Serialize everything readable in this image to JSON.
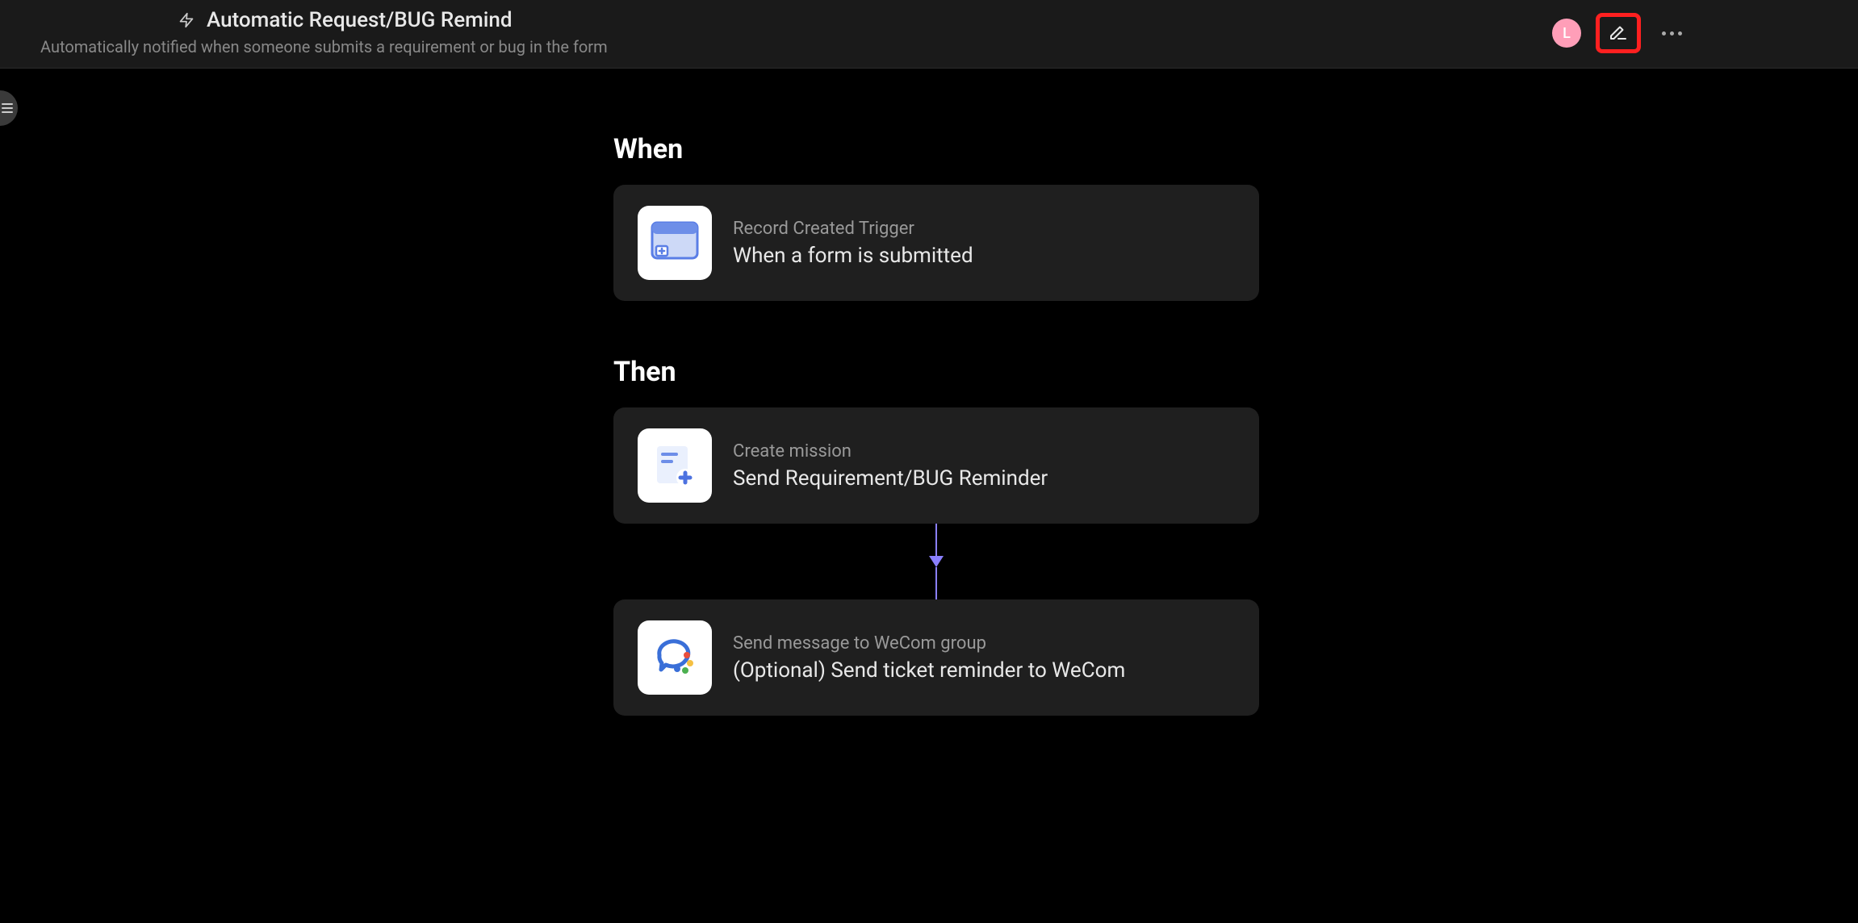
{
  "header": {
    "title": "Automatic Request/BUG Remind",
    "subtitle": "Automatically notified when someone submits a requirement or bug in the form",
    "avatar_initial": "L"
  },
  "flow": {
    "when_label": "When",
    "then_label": "Then",
    "trigger": {
      "type_label": "Record Created Trigger",
      "title": "When a form is submitted"
    },
    "actions": [
      {
        "type_label": "Create mission",
        "title": "Send Requirement/BUG Reminder",
        "icon": "create-mission"
      },
      {
        "type_label": "Send message to WeCom group",
        "title": "(Optional)  Send ticket reminder to WeCom",
        "icon": "wecom"
      }
    ]
  }
}
